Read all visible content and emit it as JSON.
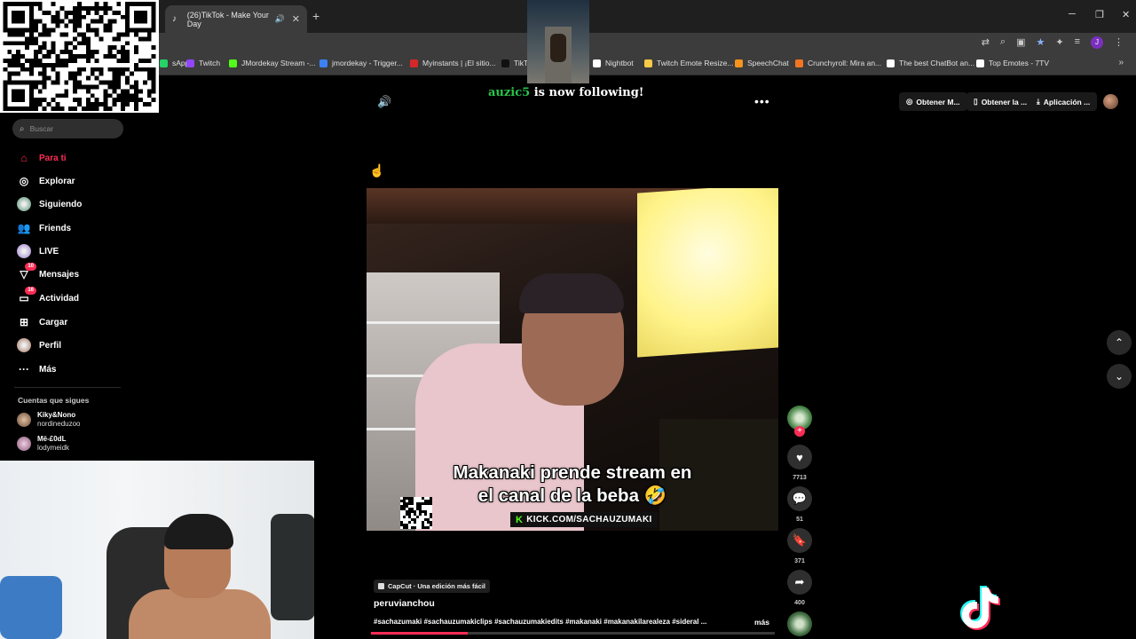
{
  "browser": {
    "tab_title": "(26)TikTok - Make Your Day",
    "bookmarks": [
      {
        "label": "sApp",
        "color": "#25d366"
      },
      {
        "label": "Twitch",
        "color": "#9146ff"
      },
      {
        "label": "JMordekay Stream -...",
        "color": "#53fc18"
      },
      {
        "label": "jmordekay - Trigger...",
        "color": "#3b82f6"
      },
      {
        "label": "Myinstants | ¡El sitio...",
        "color": "#d62828"
      },
      {
        "label": "TikTo",
        "color": "#111111"
      },
      {
        "label": "Nightbot",
        "color": "#ffffff"
      },
      {
        "label": "Twitch Emote Resize...",
        "color": "#f7c948"
      },
      {
        "label": "SpeechChat",
        "color": "#f7931e"
      },
      {
        "label": "Crunchyroll: Mira an...",
        "color": "#f47521"
      },
      {
        "label": "The best ChatBot an...",
        "color": "#ffffff"
      },
      {
        "label": "Top Emotes - 7TV",
        "color": "#ffffff"
      }
    ],
    "profile_initial": "J"
  },
  "alert": {
    "username": "auzic5",
    "text": "is now following!"
  },
  "sidebar": {
    "search_placeholder": "Buscar",
    "nav": [
      {
        "label": "Para ti",
        "icon": "home-icon",
        "active": true
      },
      {
        "label": "Explorar",
        "icon": "compass-icon"
      },
      {
        "label": "Siguiendo",
        "icon": "avatar-icon"
      },
      {
        "label": "Friends",
        "icon": "friends-icon"
      },
      {
        "label": "LIVE",
        "icon": "avatar-icon"
      },
      {
        "label": "Mensajes",
        "icon": "messages-icon",
        "badge": "10"
      },
      {
        "label": "Actividad",
        "icon": "activity-icon",
        "badge": "16"
      },
      {
        "label": "Cargar",
        "icon": "upload-icon"
      },
      {
        "label": "Perfil",
        "icon": "avatar-icon"
      },
      {
        "label": "Más",
        "icon": "more-icon"
      }
    ],
    "following_title": "Cuentas que sigues",
    "accounts": [
      {
        "name": "Kiky&Nono",
        "handle": "nordineduzoo"
      },
      {
        "name": "Më-£0dL",
        "handle": "lodymeidk"
      }
    ]
  },
  "header_actions": {
    "get_m": "Obtener M...",
    "get_la": "Obtener la ...",
    "app": "Aplicación ..."
  },
  "video": {
    "caption_line1": "Makanaki prende stream en",
    "caption_line2": "el canal de la beba",
    "caption_emoji": "🤣",
    "kick_tag": "KICK.COM/SACHAUZUMAKI",
    "progress": 0.24
  },
  "actions": {
    "likes": "7713",
    "comments": "51",
    "saves": "371",
    "shares": "400"
  },
  "post": {
    "capcut": "CapCut · Una edición más fácil",
    "author": "peruvianchou",
    "hashtags": "#sachazumaki #sachauzumakiclips #sachauzumakiedits #makanaki #makanakilarealeza #sideral ...",
    "more": "más"
  }
}
